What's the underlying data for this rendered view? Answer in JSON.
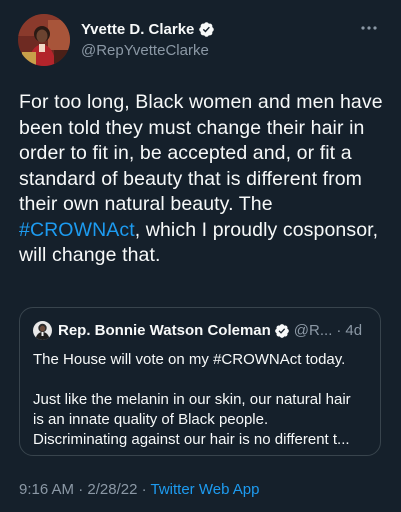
{
  "author": {
    "display_name": "Yvette D. Clarke",
    "handle": "@RepYvetteClarke",
    "avatar_icon": "avatar-photo"
  },
  "more_icon": "more-horizontal-icon",
  "tweet": {
    "text_before": "For too long, Black women and men have been told they must change their hair in order to fit in, be accepted and, or fit a standard of beauty that is different from their own natural beauty. The ",
    "hashtag": "#CROWNAct",
    "text_after": ", which I proudly cosponsor, will change that."
  },
  "quoted_tweet": {
    "display_name": "Rep. Bonnie Watson Coleman",
    "handle": "@R...",
    "separator": "·",
    "time": "4d",
    "line1": "The House will vote on my #CROWNAct today.",
    "line2": "Just like the melanin in our skin, our natural hair",
    "line3": "is an innate quality of Black people.",
    "line4": "Discriminating against our hair is no different t..."
  },
  "meta": {
    "time": "9:16 AM",
    "separator1": " · ",
    "date": "2/28/22",
    "separator2": " · ",
    "source": "Twitter Web App"
  },
  "colors": {
    "background": "#15202b",
    "primary_text": "#f7f9f9",
    "secondary_text": "#8b98a5",
    "accent": "#1d9bf0",
    "border": "#38444d"
  }
}
